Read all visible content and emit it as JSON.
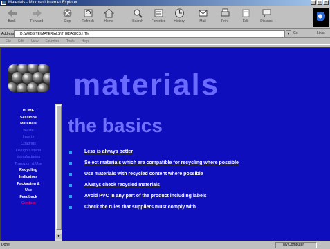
{
  "window": {
    "title": "Materials - Microsoft Internet Explorer"
  },
  "toolbar": {
    "buttons": [
      {
        "label": "Back",
        "icon": "back-arrow-icon"
      },
      {
        "label": "Forward",
        "icon": "forward-arrow-icon"
      },
      {
        "label": "Stop",
        "icon": "stop-icon"
      },
      {
        "label": "Refresh",
        "icon": "refresh-icon"
      },
      {
        "label": "Home",
        "icon": "home-icon"
      },
      {
        "label": "Search",
        "icon": "search-icon"
      },
      {
        "label": "Favorites",
        "icon": "favorites-icon"
      },
      {
        "label": "History",
        "icon": "history-icon"
      },
      {
        "label": "Mail",
        "icon": "mail-icon"
      },
      {
        "label": "Print",
        "icon": "print-icon"
      },
      {
        "label": "Edit",
        "icon": "edit-icon"
      },
      {
        "label": "Discuss",
        "icon": "discuss-icon"
      }
    ]
  },
  "address": {
    "label": "Address",
    "url": "D:\\WEBSITE\\MATERIALS\\THEBASICS.HTM",
    "go_label": "Go",
    "links_label": "Links"
  },
  "menu": {
    "items": [
      "File",
      "Edit",
      "View",
      "Favorites",
      "Tools",
      "Help"
    ]
  },
  "sidebar": {
    "nav": [
      {
        "label": "HOME",
        "state": "on"
      },
      {
        "label": "Sessions",
        "state": "on"
      },
      {
        "label": "Materials",
        "state": "on"
      },
      {
        "label": "Waste",
        "state": "off"
      },
      {
        "label": "Inserts",
        "state": "off"
      },
      {
        "label": "Coatings",
        "state": "off"
      },
      {
        "label": "Design Criteria",
        "state": "off"
      },
      {
        "label": "Manufacturing",
        "state": "off"
      },
      {
        "label": "Transport & Use",
        "state": "off"
      },
      {
        "label": "Recycling",
        "state": "on"
      },
      {
        "label": "Indicators",
        "state": "on"
      },
      {
        "label": "Packaging &",
        "state": "on"
      },
      {
        "label": "Use",
        "state": "on"
      },
      {
        "label": "Feedback",
        "state": "on"
      },
      {
        "label": "Contact",
        "state": "active"
      }
    ]
  },
  "main": {
    "heading": "materials",
    "subheading": "the basics",
    "bullets": [
      {
        "text": "Less is always better",
        "link": true
      },
      {
        "text": "Select materials which are compatible for recycling where possible",
        "link": true
      },
      {
        "text": "Use materials with recycled content where possible",
        "link": false
      },
      {
        "text": "Always check recycled materials",
        "link": true
      },
      {
        "text": "Avoid PVC in any part of the product including labels",
        "link": false
      },
      {
        "text": "Check the rules that suppliers must comply with",
        "link": false
      }
    ]
  },
  "status": {
    "left": "Done",
    "right": "My Computer"
  },
  "colors": {
    "page_bg": "#0e0ebd",
    "heading": "#6b6bff",
    "bullet_marker": "#2aa0ff",
    "nav_active": "#e2007a"
  }
}
